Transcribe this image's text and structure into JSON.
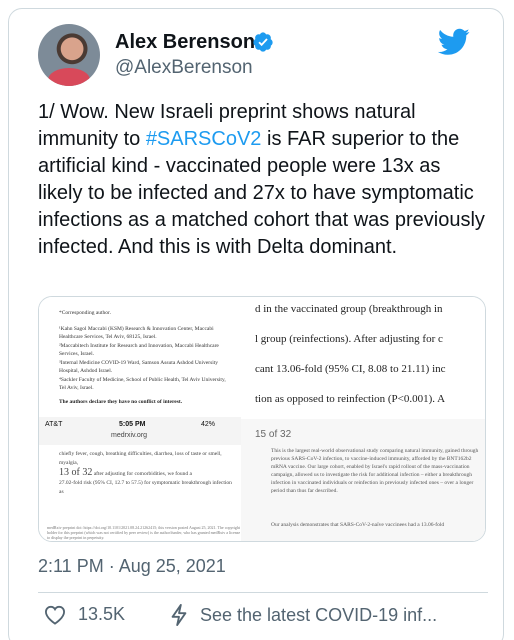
{
  "author": {
    "name": "Alex Berenson",
    "handle": "@AlexBerenson",
    "verified_icon": "verified-badge-icon",
    "brand_icon": "twitter-bird-icon"
  },
  "tweet": {
    "text_before": "1/ Wow. New Israeli preprint shows natural immunity to ",
    "hashtag": "#SARSCoV2",
    "text_after": " is FAR superior to the artificial kind - vaccinated people were 13x as likely to be infected and 27x to have symptomatic infections as a matched cohort that was previously infected. And this is with Delta dominant.",
    "timestamp": "2:11 PM · Aug 25, 2021"
  },
  "media": {
    "left_doc": {
      "corresponding": "*Corresponding author.",
      "affil_1": "¹Kahn Sagol Maccabi (KSM) Research & Innovation Center, Maccabi Healthcare Services, Tel Aviv, 68125, Israel.",
      "affil_2": "²Maccabitech Institute for Research and Innovation, Maccabi Healthcare Services, Israel.",
      "affil_3": "³Internal Medicine COVID-19 Ward, Samson Assuta Ashdod University Hospital, Ashdod Israel.",
      "affil_4": "⁴Sackler Faculty of Medicine, School of Public Health, Tel Aviv University, Tel Aviv, Israel.",
      "conflict": "The authors declare they have no conflict of interest.",
      "status_carrier": "AT&T",
      "status_time": "5:05 PM",
      "status_battery": "42%",
      "status_url": "medrxiv.org",
      "lower_1": "chiefly fever, cough, breathing difficulties, diarrhea, loss of taste or smell, myalgia,",
      "lower_page": "13 of 32",
      "lower_2": "after adjusting for comorbidities, we found a",
      "lower_3": "27.02-fold risk (95% CI, 12.7 to 57.5) for symptomatic breakthrough infection as",
      "footnote": "medRxiv preprint doi: https://doi.org/10.1101/2021.08.24.21262415; this version posted August 25, 2021. The copyright holder for this preprint (which was not certified by peer review) is the author/funder, who has granted medRxiv a license to display the preprint in perpetuity."
    },
    "right_doc": {
      "line_1": "d in the vaccinated group (breakthrough in",
      "line_2": "l group (reinfections). After adjusting for c",
      "line_3": "cant 13.06-fold (95% CI, 8.08 to 21.11) inc",
      "line_4": "tion as opposed to reinfection (P<0.001). A",
      "page_indicator": "15 of 32",
      "para_1": "This is the largest real-world observational study comparing natural immunity, gained through previous SARS-CoV-2 infection, to vaccine-induced immunity, afforded by the BNT162b2 mRNA vaccine. Our large cohort, enabled by Israel's rapid rollout of the mass-vaccination campaign, allowed us to investigate the risk for additional infection – either a breakthrough infection in vaccinated individuals or reinfection in previously infected ones – over a longer period than thus far described.",
      "para_2": "Our analysis demonstrates that SARS-CoV-2-naïve vaccinees had a 13.06-fold"
    }
  },
  "actions": {
    "likes": "13.5K",
    "covid_label": "See the latest COVID-19 inf..."
  },
  "colors": {
    "accent": "#1d9bf0",
    "text_primary": "#0f1419",
    "text_secondary": "#536471",
    "border": "#cfd9de"
  }
}
